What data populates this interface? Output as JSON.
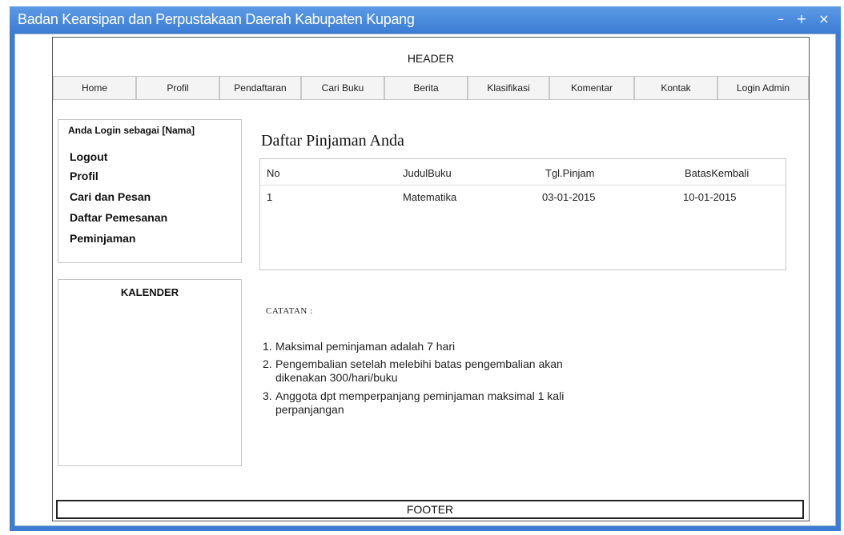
{
  "window": {
    "title": "Badan Kearsipan dan Perpustakaan Daerah Kabupaten Kupang",
    "min_glyph": "–",
    "max_glyph": "+",
    "close_glyph": "×"
  },
  "header": {
    "label": "HEADER"
  },
  "nav": {
    "tabs": [
      "Home",
      "Profil",
      "Pendaftaran",
      "Cari Buku",
      "Berita",
      "Klasifikasi",
      "Komentar",
      "Kontak",
      "Login Admin"
    ]
  },
  "sidebar": {
    "login_title": "Anda Login sebagai [Nama]",
    "menu": [
      "Logout",
      "Profil",
      "Cari dan Pesan",
      "Daftar Pemesanan",
      "Peminjaman"
    ],
    "calendar_title": "KALENDER"
  },
  "main": {
    "title": "Daftar Pinjaman Anda",
    "table": {
      "headers": [
        "No",
        "JudulBuku",
        "Tgl.Pinjam",
        "BatasKembali"
      ],
      "rows": [
        [
          "1",
          "Matematika",
          "03-01-2015",
          "10-01-2015"
        ]
      ]
    },
    "catatan_label": "CATATAN :",
    "notes": [
      {
        "num": "1.",
        "lines": [
          "Maksimal peminjaman adalah 7 hari"
        ]
      },
      {
        "num": "2.",
        "lines": [
          "Pengembalian setelah melebihi batas pengembalian akan",
          "dikenakan 300/hari/buku"
        ]
      },
      {
        "num": "3.",
        "lines": [
          "Anggota dpt memperpanjang peminjaman maksimal 1 kali",
          "perpanjangan"
        ]
      }
    ]
  },
  "footer": {
    "label": "FOOTER"
  },
  "colors": {
    "titlebar": "#3b7dd3",
    "tab_bg": "#f4f4f4"
  }
}
